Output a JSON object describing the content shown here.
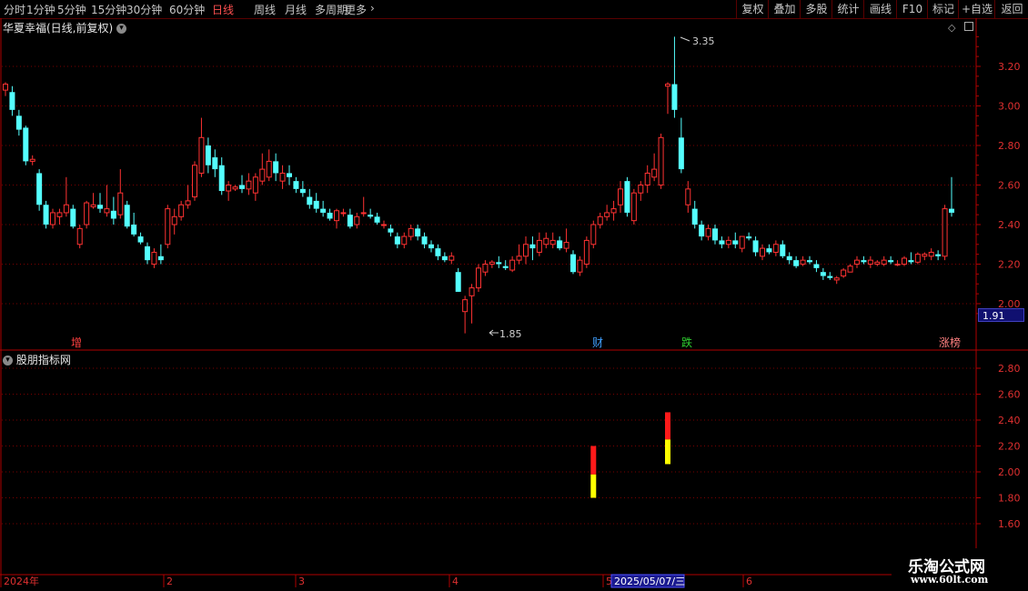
{
  "toolbar": {
    "periods": [
      "分时",
      "1分钟",
      "5分钟",
      "15分钟",
      "30分钟",
      "60分钟",
      "日线",
      "周线",
      "月线",
      "多周期",
      "更多"
    ],
    "active_period": "日线",
    "actions": [
      "复权",
      "叠加",
      "多股",
      "统计",
      "画线",
      "F10",
      "标记",
      "+自选",
      "返回"
    ]
  },
  "main_chart": {
    "title": "华夏幸福(日线,前复权)",
    "high_label": "3.35",
    "low_label": "1.85",
    "current_price": "1.91",
    "y_ticks": [
      "3.20",
      "3.00",
      "2.80",
      "2.60",
      "2.40",
      "2.20",
      "2.00"
    ],
    "markers": [
      {
        "text": "增",
        "color": "#ff4040"
      },
      {
        "text": "财",
        "color": "#40a0ff"
      },
      {
        "text": "跌",
        "color": "#30d030"
      },
      {
        "text": "涨榜",
        "color": "#ff8080"
      }
    ]
  },
  "sub_chart": {
    "title": "股朋指标网",
    "y_ticks": [
      "2.80",
      "2.60",
      "2.40",
      "2.20",
      "2.00",
      "1.80",
      "1.60"
    ]
  },
  "time_axis": {
    "labels": [
      "2024年",
      "2",
      "3",
      "4",
      "5",
      "6"
    ],
    "cursor_date": "2025/05/07/三"
  },
  "watermark": {
    "name": "乐淘公式网",
    "url": "www.60lt.com"
  },
  "colors": {
    "up": "#ff3232",
    "down": "#54ffff",
    "grid": "#7a0000",
    "axis": "#b00000"
  },
  "chart_data": {
    "type": "candlestick",
    "ylim": [
      1.91,
      3.35
    ],
    "candles": [
      [
        3.08,
        3.12,
        3.05,
        3.11
      ],
      [
        3.07,
        3.1,
        2.95,
        2.98
      ],
      [
        2.95,
        2.98,
        2.85,
        2.88
      ],
      [
        2.89,
        2.9,
        2.7,
        2.72
      ],
      [
        2.72,
        2.75,
        2.7,
        2.73
      ],
      [
        2.66,
        2.68,
        2.47,
        2.5
      ],
      [
        2.5,
        2.52,
        2.38,
        2.4
      ],
      [
        2.4,
        2.48,
        2.38,
        2.46
      ],
      [
        2.44,
        2.48,
        2.4,
        2.46
      ],
      [
        2.46,
        2.64,
        2.44,
        2.5
      ],
      [
        2.48,
        2.5,
        2.38,
        2.39
      ],
      [
        2.3,
        2.4,
        2.28,
        2.38
      ],
      [
        2.4,
        2.52,
        2.38,
        2.51
      ],
      [
        2.49,
        2.56,
        2.48,
        2.5
      ],
      [
        2.5,
        2.56,
        2.46,
        2.48
      ],
      [
        2.46,
        2.6,
        2.44,
        2.48
      ],
      [
        2.47,
        2.54,
        2.4,
        2.43
      ],
      [
        2.45,
        2.68,
        2.43,
        2.56
      ],
      [
        2.5,
        2.52,
        2.38,
        2.39
      ],
      [
        2.4,
        2.46,
        2.34,
        2.35
      ],
      [
        2.34,
        2.36,
        2.3,
        2.31
      ],
      [
        2.29,
        2.31,
        2.2,
        2.22
      ],
      [
        2.2,
        2.28,
        2.18,
        2.26
      ],
      [
        2.24,
        2.3,
        2.2,
        2.22
      ],
      [
        2.3,
        2.5,
        2.28,
        2.48
      ],
      [
        2.4,
        2.48,
        2.35,
        2.44
      ],
      [
        2.44,
        2.52,
        2.42,
        2.5
      ],
      [
        2.5,
        2.6,
        2.48,
        2.52
      ],
      [
        2.54,
        2.72,
        2.52,
        2.7
      ],
      [
        2.66,
        2.94,
        2.64,
        2.84
      ],
      [
        2.8,
        2.84,
        2.66,
        2.7
      ],
      [
        2.74,
        2.78,
        2.64,
        2.68
      ],
      [
        2.7,
        2.74,
        2.55,
        2.57
      ],
      [
        2.57,
        2.62,
        2.52,
        2.6
      ],
      [
        2.58,
        2.6,
        2.57,
        2.59
      ],
      [
        2.6,
        2.65,
        2.56,
        2.58
      ],
      [
        2.58,
        2.66,
        2.55,
        2.62
      ],
      [
        2.56,
        2.66,
        2.52,
        2.64
      ],
      [
        2.62,
        2.76,
        2.6,
        2.68
      ],
      [
        2.64,
        2.78,
        2.62,
        2.72
      ],
      [
        2.72,
        2.76,
        2.62,
        2.66
      ],
      [
        2.62,
        2.7,
        2.58,
        2.66
      ],
      [
        2.66,
        2.7,
        2.6,
        2.64
      ],
      [
        2.62,
        2.64,
        2.56,
        2.58
      ],
      [
        2.58,
        2.62,
        2.54,
        2.56
      ],
      [
        2.54,
        2.58,
        2.48,
        2.5
      ],
      [
        2.52,
        2.56,
        2.46,
        2.48
      ],
      [
        2.48,
        2.52,
        2.44,
        2.46
      ],
      [
        2.46,
        2.48,
        2.42,
        2.43
      ],
      [
        2.42,
        2.48,
        2.38,
        2.47
      ],
      [
        2.46,
        2.48,
        2.44,
        2.46
      ],
      [
        2.45,
        2.48,
        2.38,
        2.39
      ],
      [
        2.4,
        2.46,
        2.38,
        2.44
      ],
      [
        2.46,
        2.54,
        2.44,
        2.46
      ],
      [
        2.45,
        2.48,
        2.43,
        2.44
      ],
      [
        2.44,
        2.46,
        2.4,
        2.41
      ],
      [
        2.4,
        2.42,
        2.38,
        2.4
      ],
      [
        2.38,
        2.4,
        2.34,
        2.36
      ],
      [
        2.34,
        2.36,
        2.28,
        2.3
      ],
      [
        2.3,
        2.36,
        2.28,
        2.34
      ],
      [
        2.34,
        2.4,
        2.32,
        2.38
      ],
      [
        2.38,
        2.4,
        2.32,
        2.34
      ],
      [
        2.34,
        2.36,
        2.28,
        2.3
      ],
      [
        2.3,
        2.32,
        2.26,
        2.28
      ],
      [
        2.28,
        2.3,
        2.22,
        2.24
      ],
      [
        2.24,
        2.26,
        2.21,
        2.22
      ],
      [
        2.22,
        2.26,
        2.2,
        2.24
      ],
      [
        2.16,
        2.18,
        2.06,
        2.06
      ],
      [
        1.96,
        2.04,
        1.85,
        2.02
      ],
      [
        2.04,
        2.1,
        1.9,
        2.08
      ],
      [
        2.08,
        2.2,
        2.06,
        2.18
      ],
      [
        2.16,
        2.22,
        2.14,
        2.2
      ],
      [
        2.2,
        2.22,
        2.18,
        2.21
      ],
      [
        2.21,
        2.24,
        2.18,
        2.2
      ],
      [
        2.19,
        2.22,
        2.17,
        2.18
      ],
      [
        2.17,
        2.24,
        2.16,
        2.22
      ],
      [
        2.22,
        2.3,
        2.2,
        2.24
      ],
      [
        2.24,
        2.34,
        2.2,
        2.3
      ],
      [
        2.3,
        2.34,
        2.22,
        2.28
      ],
      [
        2.26,
        2.36,
        2.24,
        2.32
      ],
      [
        2.3,
        2.36,
        2.28,
        2.33
      ],
      [
        2.3,
        2.36,
        2.28,
        2.32
      ],
      [
        2.32,
        2.34,
        2.27,
        2.28
      ],
      [
        2.28,
        2.38,
        2.26,
        2.31
      ],
      [
        2.25,
        2.27,
        2.15,
        2.16
      ],
      [
        2.16,
        2.24,
        2.14,
        2.22
      ],
      [
        2.2,
        2.34,
        2.18,
        2.32
      ],
      [
        2.3,
        2.42,
        2.28,
        2.4
      ],
      [
        2.4,
        2.46,
        2.38,
        2.44
      ],
      [
        2.44,
        2.5,
        2.42,
        2.46
      ],
      [
        2.46,
        2.52,
        2.42,
        2.48
      ],
      [
        2.5,
        2.62,
        2.46,
        2.58
      ],
      [
        2.62,
        2.64,
        2.44,
        2.46
      ],
      [
        2.42,
        2.58,
        2.4,
        2.56
      ],
      [
        2.56,
        2.62,
        2.52,
        2.6
      ],
      [
        2.6,
        2.7,
        2.56,
        2.66
      ],
      [
        2.64,
        2.76,
        2.62,
        2.68
      ],
      [
        2.6,
        2.86,
        2.58,
        2.84
      ],
      [
        3.1,
        3.12,
        2.96,
        3.11
      ],
      [
        3.11,
        3.35,
        2.94,
        2.98
      ],
      [
        2.84,
        2.94,
        2.66,
        2.68
      ],
      [
        2.5,
        2.62,
        2.46,
        2.58
      ],
      [
        2.48,
        2.52,
        2.38,
        2.4
      ],
      [
        2.4,
        2.42,
        2.32,
        2.34
      ],
      [
        2.34,
        2.4,
        2.32,
        2.38
      ],
      [
        2.38,
        2.4,
        2.3,
        2.32
      ],
      [
        2.32,
        2.34,
        2.28,
        2.3
      ],
      [
        2.3,
        2.34,
        2.28,
        2.32
      ],
      [
        2.32,
        2.36,
        2.28,
        2.3
      ],
      [
        2.28,
        2.34,
        2.26,
        2.34
      ],
      [
        2.34,
        2.36,
        2.32,
        2.33
      ],
      [
        2.32,
        2.34,
        2.24,
        2.26
      ],
      [
        2.24,
        2.3,
        2.22,
        2.28
      ],
      [
        2.28,
        2.3,
        2.25,
        2.26
      ],
      [
        2.26,
        2.32,
        2.24,
        2.3
      ],
      [
        2.3,
        2.32,
        2.23,
        2.24
      ],
      [
        2.24,
        2.26,
        2.2,
        2.22
      ],
      [
        2.22,
        2.24,
        2.18,
        2.19
      ],
      [
        2.2,
        2.24,
        2.19,
        2.22
      ],
      [
        2.22,
        2.24,
        2.2,
        2.21
      ],
      [
        2.2,
        2.22,
        2.16,
        2.18
      ],
      [
        2.16,
        2.18,
        2.12,
        2.14
      ],
      [
        2.14,
        2.16,
        2.12,
        2.13
      ],
      [
        2.12,
        2.14,
        2.1,
        2.13
      ],
      [
        2.14,
        2.18,
        2.13,
        2.17
      ],
      [
        2.16,
        2.2,
        2.16,
        2.19
      ],
      [
        2.2,
        2.24,
        2.18,
        2.22
      ],
      [
        2.22,
        2.24,
        2.2,
        2.21
      ],
      [
        2.2,
        2.24,
        2.18,
        2.22
      ],
      [
        2.2,
        2.22,
        2.19,
        2.21
      ],
      [
        2.2,
        2.24,
        2.19,
        2.22
      ],
      [
        2.22,
        2.24,
        2.2,
        2.21
      ],
      [
        2.2,
        2.22,
        2.19,
        2.2
      ],
      [
        2.2,
        2.24,
        2.19,
        2.23
      ],
      [
        2.22,
        2.26,
        2.2,
        2.21
      ],
      [
        2.21,
        2.26,
        2.2,
        2.25
      ],
      [
        2.24,
        2.26,
        2.22,
        2.25
      ],
      [
        2.24,
        2.28,
        2.22,
        2.26
      ],
      [
        2.25,
        2.27,
        2.22,
        2.24
      ],
      [
        2.24,
        2.5,
        2.22,
        2.48
      ],
      [
        2.48,
        2.64,
        2.44,
        2.46
      ]
    ],
    "indicator_bars": [
      {
        "index": 87,
        "red": [
          1.98,
          2.2
        ],
        "yellow": [
          1.8,
          1.98
        ]
      },
      {
        "index": 98,
        "red": [
          2.25,
          2.46
        ],
        "yellow": [
          2.06,
          2.25
        ]
      }
    ],
    "sub_ylim": [
      1.6,
      2.8
    ]
  }
}
